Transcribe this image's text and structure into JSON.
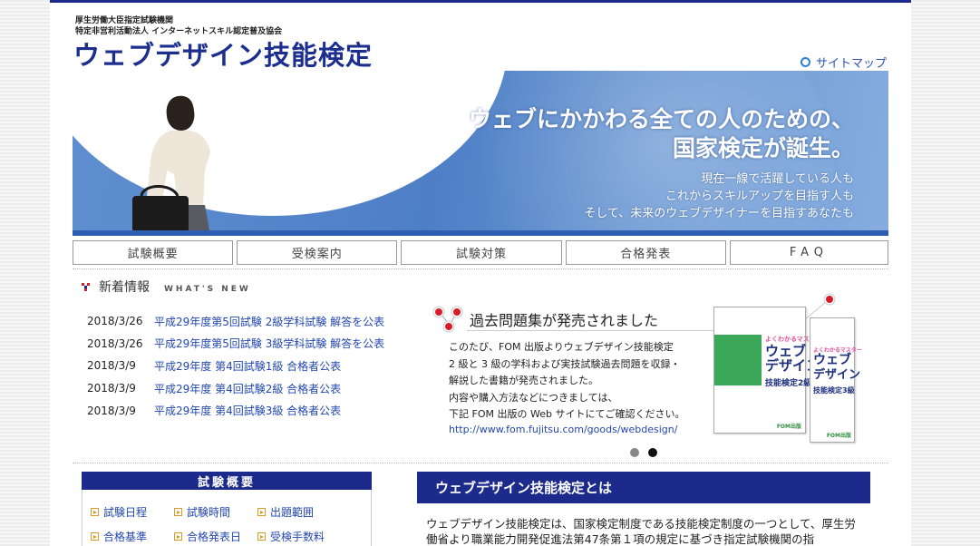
{
  "header": {
    "org_line1": "厚生労働大臣指定試験機関",
    "org_line2": "特定非営利活動法人 インターネットスキル認定普及協会",
    "logo": "ウェブデザイン技能検定",
    "sitemap": "サイトマップ"
  },
  "hero": {
    "headline1": "ウェブにかかわる全ての人のための、",
    "headline2": "国家検定が誕生。",
    "sub": [
      "現在一線で活躍している人も",
      "これからスキルアップを目指す人も",
      "そして、未来のウェブデザイナーを目指すあなたも"
    ]
  },
  "nav": [
    "試験概要",
    "受検案内",
    "試験対策",
    "合格発表",
    "FAQ"
  ],
  "news": {
    "title": "新着情報",
    "subtitle": "WHAT'S NEW",
    "items": [
      {
        "date": "2018/3/26",
        "text": "平成29年度第5回試験 2級学科試験 解答を公表"
      },
      {
        "date": "2018/3/26",
        "text": "平成29年度第5回試験 3級学科試験 解答を公表"
      },
      {
        "date": "2018/3/9",
        "text": "平成29年度 第4回試験1級 合格者公表"
      },
      {
        "date": "2018/3/9",
        "text": "平成29年度 第4回試験2級 合格者公表"
      },
      {
        "date": "2018/3/9",
        "text": "平成29年度 第4回試験3級 合格者公表"
      }
    ]
  },
  "promo": {
    "title": "過去問題集が発売されました",
    "lines": [
      "このたび、FOM 出版よりウェブデザイン技能検定",
      "2 級と 3 級の学科および実技試験過去問題を収録・",
      "解説した書籍が発売されました。",
      "内容や購入方法などにつきましては、",
      "下記 FOM 出版の Web サイトにてご確認ください。"
    ],
    "url": "http://www.fom.fujitsu.com/goods/webdesign/",
    "book1": {
      "series": "よくわかるマスター",
      "title1": "ウェブ",
      "title2": "デザイン",
      "grade": "技能検定2級",
      "publisher": "FOM出版"
    },
    "book2": {
      "series": "よくわかるマスター",
      "title1": "ウェブ",
      "title2": "デザイン",
      "grade": "技能検定3級",
      "publisher": "FOM出版"
    },
    "active_slide": 2
  },
  "overview": {
    "title": "試験概要",
    "links": [
      "試験日程",
      "試験時間",
      "出題範囲",
      "合格基準",
      "合格発表日",
      "受検手数料"
    ]
  },
  "about": {
    "title": "ウェブデザイン技能検定とは",
    "text": "ウェブデザイン技能検定は、国家検定制度である技能検定制度の一つとして、厚生労働省より職業能力開発促進法第47条第１項の規定に基づき指定試験機関の指"
  },
  "colors": {
    "navy": "#1c2a8c",
    "link": "#2247b0",
    "accent_red": "#d91c2c"
  }
}
